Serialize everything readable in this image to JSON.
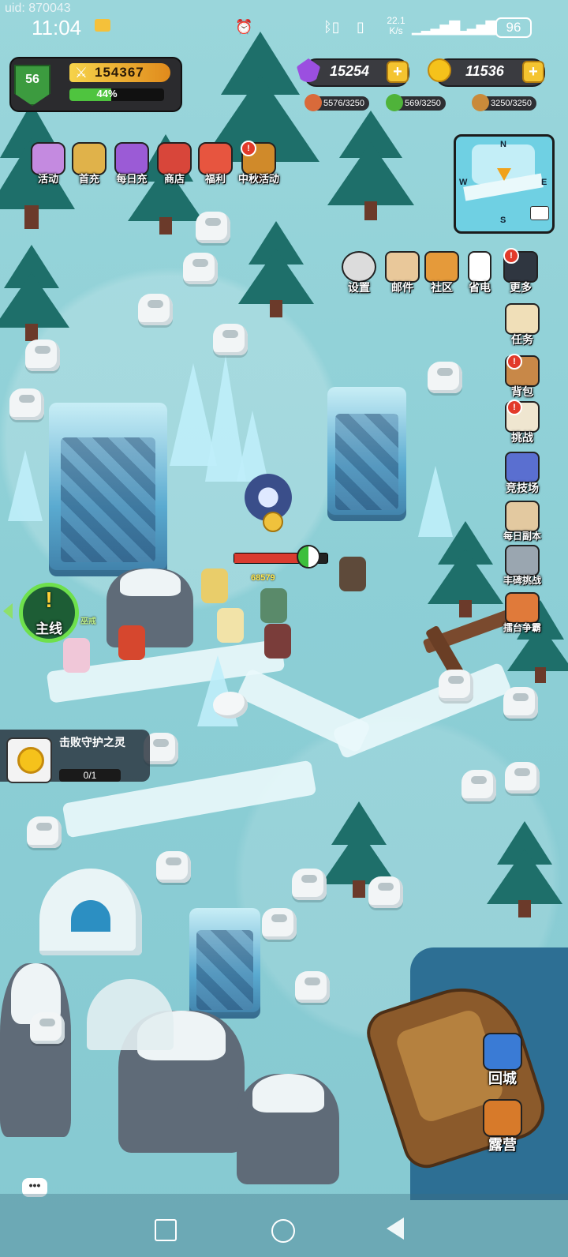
{
  "status_bar": {
    "uid": "uid: 870043",
    "time": "11:04",
    "network_speed": "22.1 K/s",
    "battery": "96",
    "icons": [
      "mail-icon",
      "alarm-icon",
      "bluetooth-icon",
      "vibrate-icon",
      "signal-icon",
      "signal-icon",
      "battery-icon"
    ]
  },
  "player": {
    "level": "56",
    "power": "154367",
    "xp_percent_text": "44%",
    "xp_fraction": 0.44
  },
  "resources": {
    "gems": "15254",
    "gold": "11536",
    "meat": "5576/3250",
    "herb": "569/3250",
    "bread": "3250/3250"
  },
  "top_menu": [
    {
      "label": "活动",
      "icon": "gift-box-icon",
      "color": "#c48ae0"
    },
    {
      "label": "首充",
      "icon": "king-crown-icon",
      "color": "#e0b24a"
    },
    {
      "label": "每日充",
      "icon": "grape-chest-icon",
      "color": "#9b5bd6"
    },
    {
      "label": "商店",
      "icon": "shop-stall-icon",
      "color": "#d8463a"
    },
    {
      "label": "福利",
      "icon": "present-icon",
      "color": "#e7553f"
    },
    {
      "label": "中秋活动",
      "icon": "mooncake-icon",
      "color": "#d08a2a",
      "badge": "!"
    }
  ],
  "utility_menu": [
    {
      "label": "设置",
      "icon": "gear-icon"
    },
    {
      "label": "邮件",
      "icon": "envelope-icon"
    },
    {
      "label": "社区",
      "icon": "house-icon"
    },
    {
      "label": "省电",
      "icon": "battery-saver-icon"
    },
    {
      "label": "更多",
      "icon": "grid-more-icon",
      "badge": "!"
    }
  ],
  "side_menu": [
    {
      "label": "任务",
      "icon": "scroll-icon"
    },
    {
      "label": "背包",
      "icon": "backpack-icon",
      "badge": "!"
    },
    {
      "label": "挑战",
      "icon": "challenge-banner-icon",
      "badge": "!"
    },
    {
      "label": "竞技场",
      "icon": "arena-trophy-icon"
    },
    {
      "label": "每日副本",
      "icon": "daily-dungeon-icon"
    },
    {
      "label": "丰碑挑战",
      "icon": "monument-icon"
    },
    {
      "label": "擂台争霸",
      "icon": "ring-crown-icon"
    }
  ],
  "minimap": {
    "n": "N",
    "s": "S",
    "w": "W",
    "e": "E"
  },
  "main_quest": {
    "mark": "!",
    "label": "主线"
  },
  "task": {
    "text": "击败守护之灵",
    "progress": "0/1"
  },
  "battle": {
    "damage_text": "68579",
    "hero_name": "巫戒",
    "boss_hp_fraction": 0.72
  },
  "bottom_right": [
    {
      "label": "回城",
      "icon": "portal-icon"
    },
    {
      "label": "露营",
      "icon": "campfire-tent-icon"
    }
  ],
  "chat": {
    "label": "•••"
  },
  "colors": {
    "hud_dark": "#2b2b2e",
    "xp_green": "#4fc43f",
    "power_gold": "#f6d34a",
    "gem_purple": "#9b4fe0",
    "coin_gold": "#f5c21b",
    "quest_green": "#6ee04c"
  }
}
